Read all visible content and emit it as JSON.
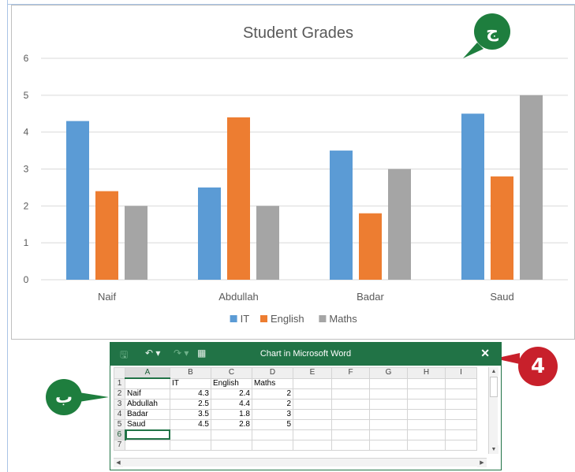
{
  "chart_data": {
    "type": "bar",
    "title": "Student Grades",
    "categories": [
      "Naif",
      "Abdullah",
      "Badar",
      "Saud"
    ],
    "series": [
      {
        "name": "IT",
        "color": "#5b9bd5",
        "values": [
          4.3,
          2.5,
          3.5,
          4.5
        ]
      },
      {
        "name": "English",
        "color": "#ed7d31",
        "values": [
          2.4,
          4.4,
          1.8,
          2.8
        ]
      },
      {
        "name": "Maths",
        "color": "#a5a5a5",
        "values": [
          2,
          2,
          3,
          5
        ]
      }
    ],
    "ylim": [
      0,
      6
    ],
    "yticks": [
      0,
      1,
      2,
      3,
      4,
      5,
      6
    ],
    "grid": true,
    "legend": "bottom"
  },
  "badges": {
    "chart_badge": "ج",
    "sheet_badge": "ب",
    "close_badge": "4"
  },
  "excel": {
    "title": "Chart in Microsoft Word",
    "close": "✕",
    "save_icon": "🖫",
    "undo_icon": "↶ ▾",
    "redo_icon": "↷ ▾",
    "sheet_icon": "▦",
    "columns": [
      "A",
      "B",
      "C",
      "D",
      "E",
      "F",
      "G",
      "H",
      "I"
    ],
    "rows": [
      {
        "n": "1",
        "cells": [
          "",
          "IT",
          "English",
          "Maths"
        ]
      },
      {
        "n": "2",
        "cells": [
          "Naif",
          "4.3",
          "2.4",
          "2"
        ]
      },
      {
        "n": "3",
        "cells": [
          "Abdullah",
          "2.5",
          "4.4",
          "2"
        ]
      },
      {
        "n": "4",
        "cells": [
          "Badar",
          "3.5",
          "1.8",
          "3"
        ]
      },
      {
        "n": "5",
        "cells": [
          "Saud",
          "4.5",
          "2.8",
          "5"
        ]
      },
      {
        "n": "6",
        "cells": [
          "",
          "",
          "",
          ""
        ]
      },
      {
        "n": "7",
        "cells": [
          "",
          "",
          "",
          ""
        ]
      }
    ]
  },
  "colors": {
    "excel_green": "#217346",
    "badge_green": "#1e7e3e",
    "badge_red": "#c8202b"
  }
}
